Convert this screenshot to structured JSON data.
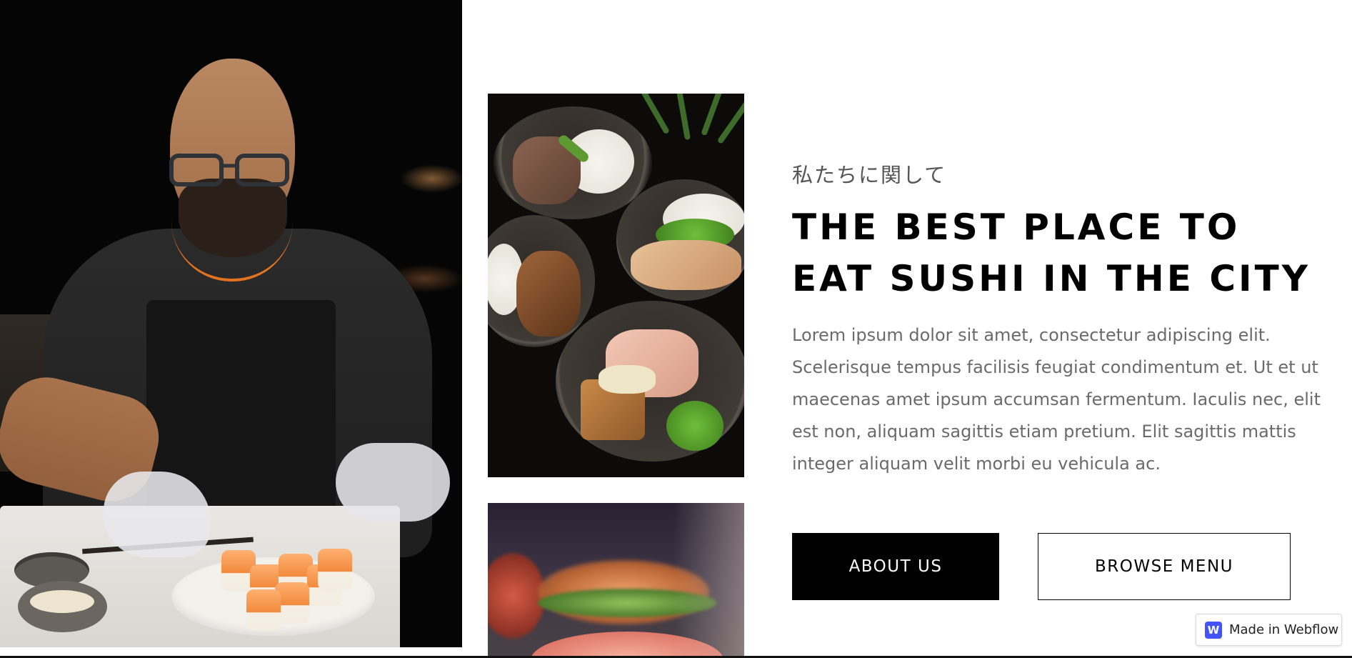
{
  "about_section": {
    "subtitle": "私たちに関して",
    "heading_line1": "THE BEST PLACE TO",
    "heading_line2": "EAT SUSHI IN THE CITY",
    "body": "Lorem ipsum dolor sit amet, consectetur adipiscing elit. Scelerisque tempus facilisis feugiat condimentum et. Ut et ut maecenas amet ipsum accumsan fermentum. Iaculis nec, elit est non, aliquam sagittis etiam pretium. Elit sagittis mattis integer aliquam velit morbi eu vehicula ac."
  },
  "buttons": {
    "about_us": "ABOUT US",
    "browse_menu": "BROWSE MENU"
  },
  "badge": {
    "logo_letter": "W",
    "label": "Made in Webflow",
    "logo_color": "#4353ff"
  },
  "images": {
    "hero": "chef-preparing-sushi-photo",
    "food": "food-bowls-photo",
    "sushi": "sushi-closeup-photo"
  },
  "colors": {
    "primary": "#000000",
    "body_text": "#6a6a6a",
    "accent_orange": "#e2731f"
  }
}
